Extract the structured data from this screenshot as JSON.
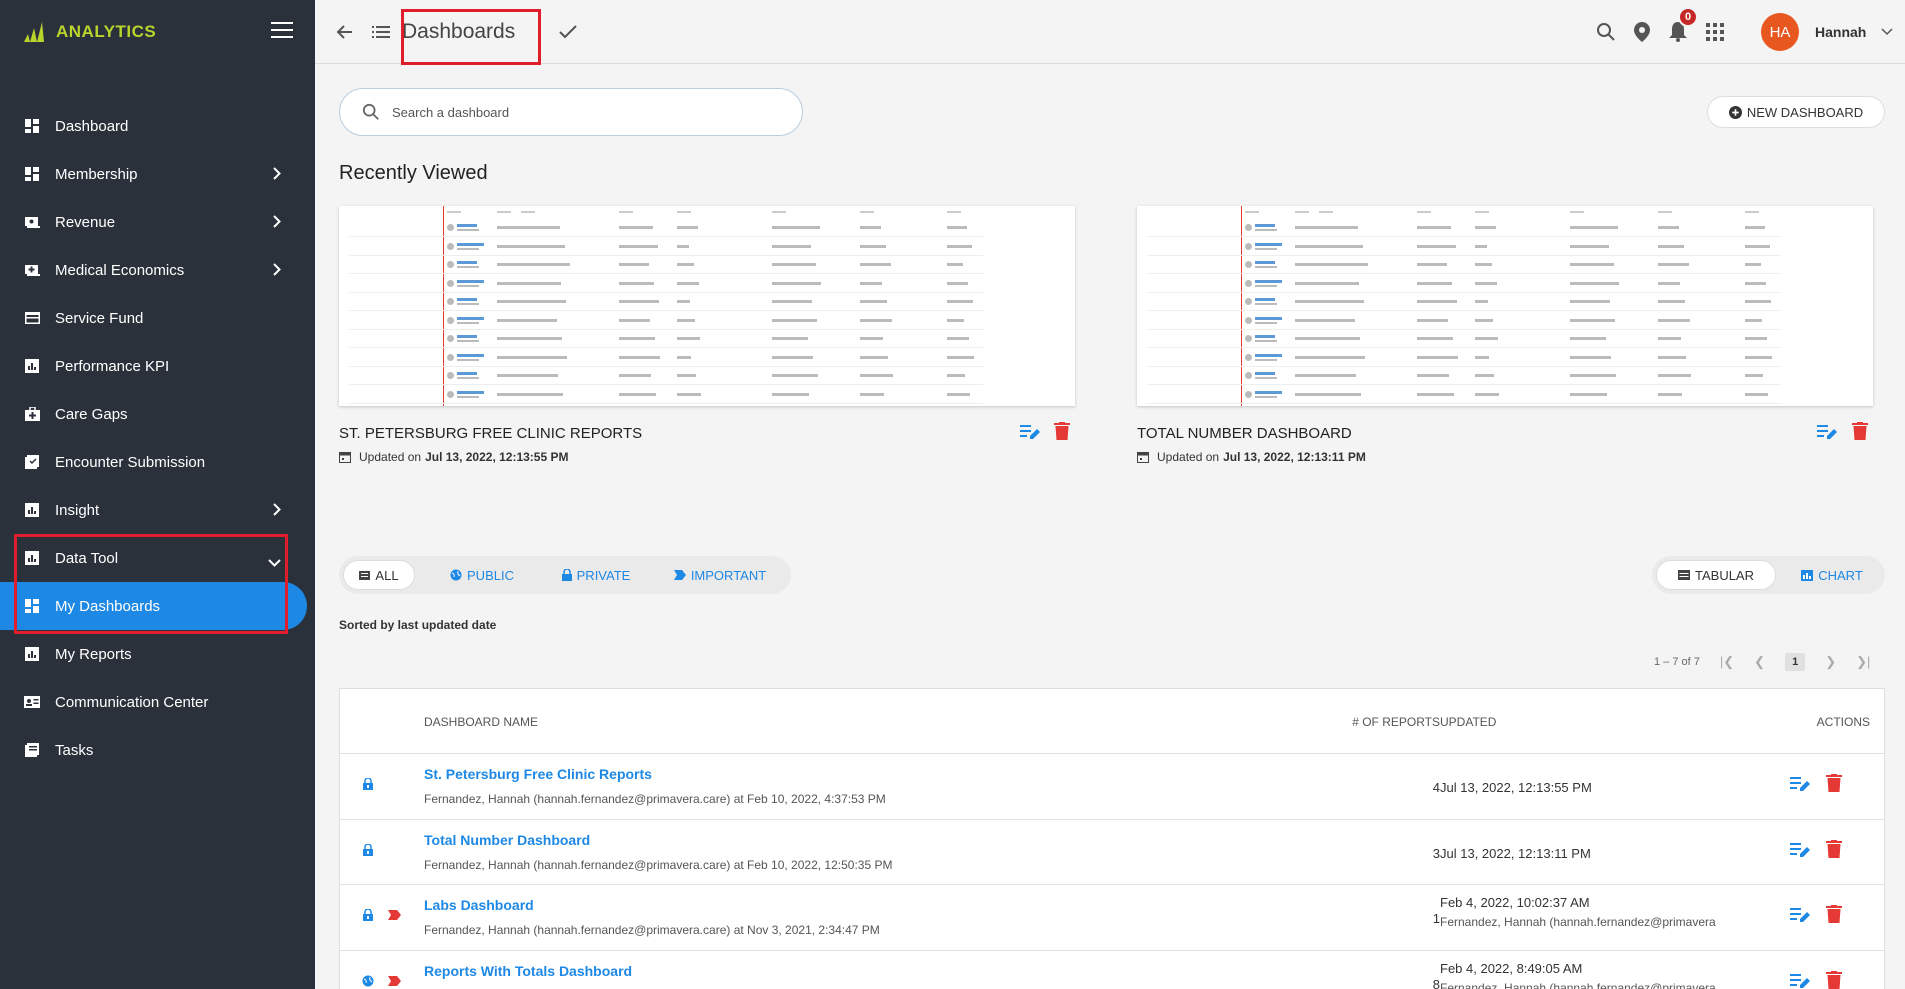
{
  "app": {
    "brand": "ANALYTICS",
    "accent": "#1e88e5",
    "brand_color": "#b9d42c"
  },
  "sidebar": {
    "items": [
      {
        "label": "Dashboard",
        "icon": "dashboard-icon",
        "chevron": ""
      },
      {
        "label": "Membership",
        "icon": "dashboard-icon",
        "chevron": "right"
      },
      {
        "label": "Revenue",
        "icon": "revenue-icon",
        "chevron": "right"
      },
      {
        "label": "Medical Economics",
        "icon": "medical-icon",
        "chevron": "right"
      },
      {
        "label": "Service Fund",
        "icon": "card-icon",
        "chevron": ""
      },
      {
        "label": "Performance KPI",
        "icon": "chart-icon",
        "chevron": ""
      },
      {
        "label": "Care Gaps",
        "icon": "medkit-icon",
        "chevron": ""
      },
      {
        "label": "Encounter Submission",
        "icon": "encounter-icon",
        "chevron": ""
      },
      {
        "label": "Insight",
        "icon": "chart-icon",
        "chevron": "right"
      },
      {
        "label": "Data Tool",
        "icon": "chart-icon",
        "chevron": "down"
      },
      {
        "label": "My Dashboards",
        "icon": "dashboard-icon",
        "chevron": "",
        "active": true
      },
      {
        "label": "My Reports",
        "icon": "chart-icon",
        "chevron": ""
      },
      {
        "label": "Communication Center",
        "icon": "contact-card-icon",
        "chevron": ""
      },
      {
        "label": "Tasks",
        "icon": "tasks-icon",
        "chevron": ""
      }
    ]
  },
  "header": {
    "title": "Dashboards",
    "user_initials": "HA",
    "user_name": "Hannah",
    "notification_count": "0"
  },
  "search": {
    "placeholder": "Search a dashboard"
  },
  "new_dashboard_label": "NEW DASHBOARD",
  "recently_viewed": {
    "title": "Recently Viewed",
    "cards": [
      {
        "title": "ST. PETERSBURG FREE CLINIC REPORTS",
        "updated_prefix": "Updated on",
        "updated": "Jul 13, 2022, 12:13:55 PM"
      },
      {
        "title": "TOTAL NUMBER DASHBOARD",
        "updated_prefix": "Updated on",
        "updated": "Jul 13, 2022, 12:13:11 PM"
      }
    ]
  },
  "filters": {
    "tabs": [
      "ALL",
      "PUBLIC",
      "PRIVATE",
      "IMPORTANT"
    ],
    "active": "ALL"
  },
  "views": {
    "tabs": [
      "TABULAR",
      "CHART"
    ],
    "active": "TABULAR"
  },
  "sorted_label": "Sorted by last updated date",
  "pagination": {
    "range": "1 – 7 of 7",
    "page": "1"
  },
  "table": {
    "headers": {
      "name": "DASHBOARD NAME",
      "reports": "# OF REPORTS",
      "updated": "UPDATED",
      "actions": "ACTIONS"
    },
    "rows": [
      {
        "name": "St. Petersburg Free Clinic Reports",
        "sub": "Fernandez, Hannah (hannah.fernandez@primavera.care) at Feb 10, 2022, 4:37:53 PM",
        "reports": "4",
        "updated": "Jul 13, 2022, 12:13:55 PM",
        "updated_by": "",
        "visibility": "private",
        "important": false
      },
      {
        "name": "Total Number Dashboard",
        "sub": "Fernandez, Hannah (hannah.fernandez@primavera.care) at Feb 10, 2022, 12:50:35 PM",
        "reports": "3",
        "updated": "Jul 13, 2022, 12:13:11 PM",
        "updated_by": "",
        "visibility": "private",
        "important": false
      },
      {
        "name": "Labs Dashboard",
        "sub": "Fernandez, Hannah (hannah.fernandez@primavera.care) at Nov 3, 2021, 2:34:47 PM",
        "reports": "1",
        "updated": "Feb 4, 2022, 10:02:37 AM",
        "updated_by": "Fernandez, Hannah (hannah.fernandez@primavera",
        "visibility": "private",
        "important": true
      },
      {
        "name": "Reports With Totals Dashboard",
        "sub": "",
        "reports": "8",
        "updated": "Feb 4, 2022, 8:49:05 AM",
        "updated_by": "Fernandez, Hannah (hannah.fernandez@primavera",
        "visibility": "public",
        "important": true
      }
    ]
  }
}
